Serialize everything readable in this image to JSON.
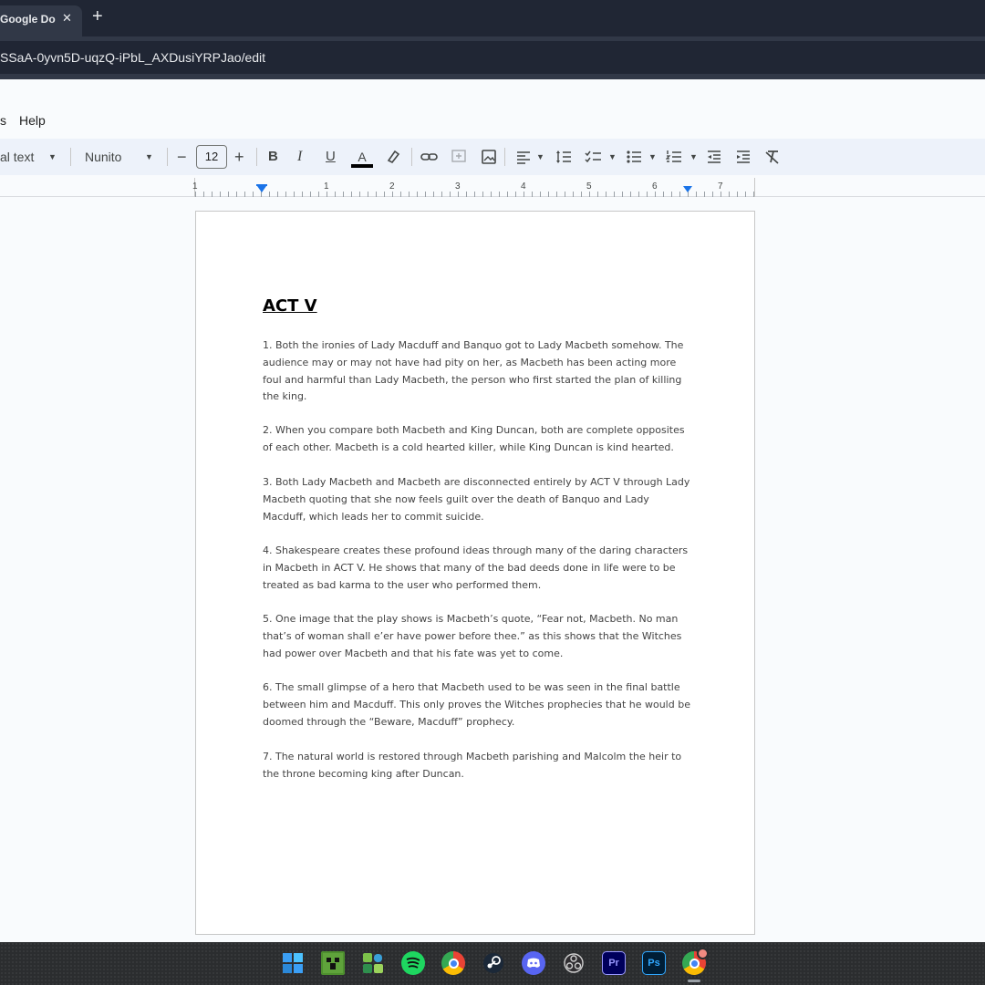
{
  "browser": {
    "tab_title": "Google Do",
    "tab_close": "✕",
    "new_tab": "+",
    "url": "SSaA-0yvn5D-uqzQ-iPbL_AXDusiYRPJao/edit"
  },
  "menu": {
    "items": [
      "s",
      "Help"
    ]
  },
  "toolbar": {
    "style_label": "al text",
    "font_label": "Nunito",
    "font_size": "12",
    "minus": "−",
    "plus": "+",
    "bold": "B",
    "italic": "I",
    "underline": "U",
    "text_color": "A"
  },
  "ruler": {
    "numbers": [
      "1",
      "1",
      "1",
      "2",
      "3",
      "4",
      "5",
      "6",
      "7"
    ]
  },
  "document": {
    "heading": "ACT V",
    "paragraphs": [
      "1. Both the ironies of Lady Macduff and Banquo got to Lady Macbeth somehow. The audience may or may not have had pity on her, as Macbeth has been acting more foul and harmful than Lady Macbeth, the person who first started the plan of killing the king.",
      "2. When you compare both Macbeth and King Duncan, both are complete opposites of each other. Macbeth is a cold hearted killer, while King Duncan is kind hearted.",
      "3. Both Lady Macbeth and Macbeth are disconnected entirely by ACT V through Lady Macbeth quoting that she now feels guilt over the death of Banquo and Lady Macduff, which leads her to commit suicide.",
      "4. Shakespeare creates these profound ideas through many of the daring characters in Macbeth in ACT V. He shows that many of the bad deeds done in life were to be treated as bad karma to the user who performed them.",
      "5. One image that the play shows is Macbeth’s quote, “Fear not, Macbeth. No man that’s of woman shall e’er have power before thee.” as this shows that the Witches had power over Macbeth and that his fate was yet to come.",
      "6. The small glimpse of a hero that Macbeth used to be was seen in the final battle between him and Macduff. This only proves the Witches prophecies that he would be doomed through the “Beware, Macduff” prophecy.",
      "7. The natural world is restored through Macbeth parishing and Malcolm the heir to the throne becoming king after Duncan."
    ]
  },
  "taskbar": {
    "icons": [
      "windows-start",
      "minecraft",
      "app-green",
      "spotify",
      "chrome",
      "steam",
      "discord",
      "obs",
      "premiere-pro",
      "photoshop",
      "chrome-profile"
    ],
    "premiere_label": "Pr",
    "photoshop_label": "Ps"
  },
  "colors": {
    "accent": "#1a73e8",
    "toolbar_bg": "#edf2fa",
    "chrome_dark": "#202634"
  }
}
